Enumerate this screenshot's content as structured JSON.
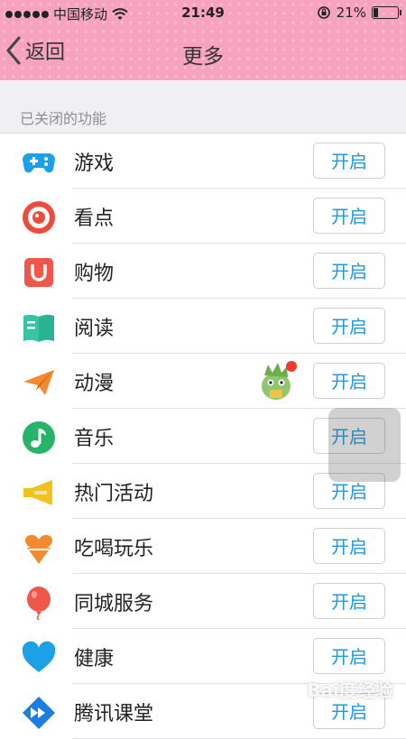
{
  "status_bar": {
    "carrier": "中国移动",
    "time": "21:49",
    "battery": "21%"
  },
  "nav": {
    "back_label": "返回",
    "title": "更多"
  },
  "section_title": "已关闭的功能",
  "items": [
    {
      "label": "游戏",
      "icon": "gamepad-icon",
      "button": "开启"
    },
    {
      "label": "看点",
      "icon": "eye-circle-icon",
      "button": "开启"
    },
    {
      "label": "购物",
      "icon": "shopping-bag-icon",
      "button": "开启"
    },
    {
      "label": "阅读",
      "icon": "book-icon",
      "button": "开启"
    },
    {
      "label": "动漫",
      "icon": "paper-plane-icon",
      "button": "开启"
    },
    {
      "label": "音乐",
      "icon": "music-note-icon",
      "button": "开启"
    },
    {
      "label": "热门活动",
      "icon": "megaphone-icon",
      "button": "开启"
    },
    {
      "label": "吃喝玩乐",
      "icon": "ice-cream-heart-icon",
      "button": "开启"
    },
    {
      "label": "同城服务",
      "icon": "balloon-icon",
      "button": "开启"
    },
    {
      "label": "健康",
      "icon": "heart-icon",
      "button": "开启"
    },
    {
      "label": "腾讯课堂",
      "icon": "fast-forward-icon",
      "button": "开启"
    }
  ],
  "watermark": "Bai度经验",
  "colors": {
    "header": "#f7a3bf",
    "accent": "#1e9ae0",
    "background": "#efeff4"
  }
}
